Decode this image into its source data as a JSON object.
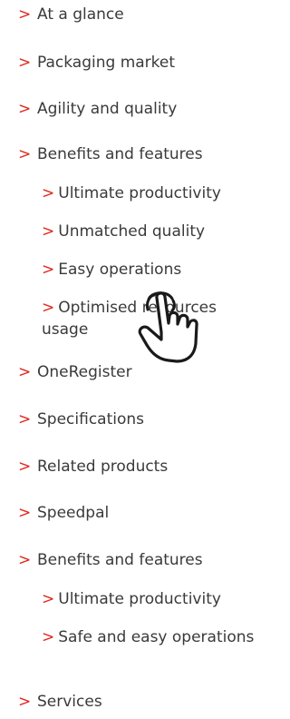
{
  "nav": {
    "items": [
      {
        "label": "At a glance"
      },
      {
        "label": "Packaging market"
      },
      {
        "label": "Agility and quality"
      },
      {
        "label": "Benefits and features"
      },
      {
        "label": "Ultimate productivity"
      },
      {
        "label": "Unmatched quality"
      },
      {
        "label": "Easy operations"
      },
      {
        "label": "Optimised resources usage"
      },
      {
        "label": "OneRegister"
      },
      {
        "label": "Specifications"
      },
      {
        "label": "Related products"
      },
      {
        "label": "Speedpal"
      },
      {
        "label": "Benefits and features"
      },
      {
        "label": "Ultimate productivity"
      },
      {
        "label": "Safe and easy operations"
      },
      {
        "label": "Services"
      }
    ],
    "arrow_glyph": ">"
  },
  "colors": {
    "accent": "#e1261c",
    "text": "#3a3a3a"
  },
  "icons": {
    "pointer": "pointing-hand-icon"
  }
}
